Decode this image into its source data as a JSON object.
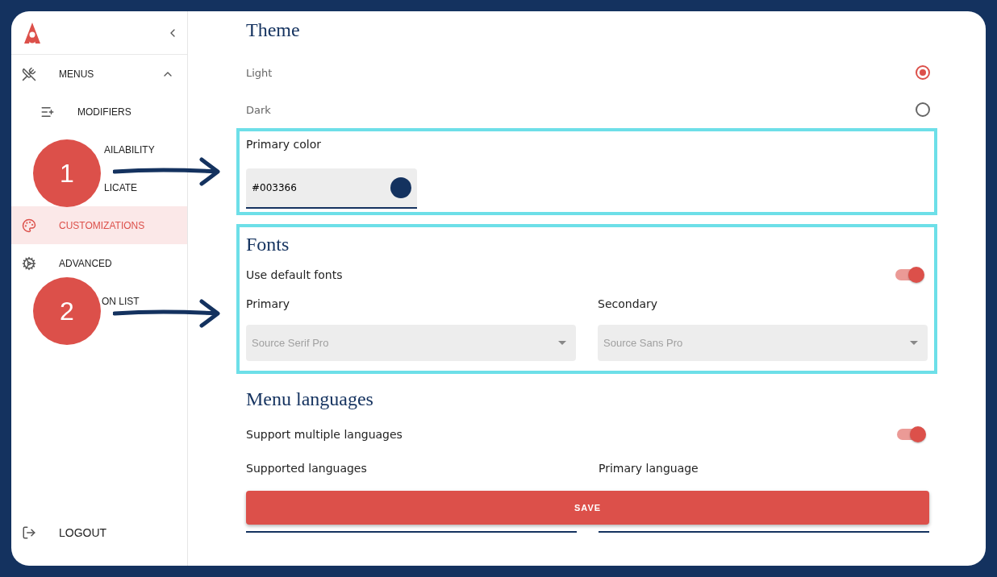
{
  "sidebar": {
    "items": [
      {
        "kind": "group",
        "label": "MENUS",
        "expanded": true,
        "selected": false
      },
      {
        "kind": "sub",
        "label": "MODIFIERS",
        "selected": false
      },
      {
        "kind": "cut-sub",
        "label": "AILABILITY",
        "selected": false
      },
      {
        "kind": "cut-sub",
        "label": "LICATE",
        "selected": false
      },
      {
        "kind": "item",
        "label": "CUSTOMIZATIONS",
        "selected": true
      },
      {
        "kind": "item",
        "label": "ADVANCED",
        "selected": false
      },
      {
        "kind": "cut-item",
        "label": "ON LIST",
        "selected": false
      }
    ],
    "logout": "LOGOUT"
  },
  "theme": {
    "title": "Theme",
    "options": [
      {
        "label": "Light",
        "selected": true
      },
      {
        "label": "Dark",
        "selected": false
      }
    ],
    "primary_color": {
      "label": "Primary color",
      "value": "#003366"
    }
  },
  "fonts": {
    "title": "Fonts",
    "use_default": {
      "label": "Use default fonts",
      "on": true
    },
    "selects": [
      {
        "label": "Primary",
        "placeholder": "Source Serif Pro"
      },
      {
        "label": "Secondary",
        "placeholder": "Source Sans Pro"
      }
    ]
  },
  "languages": {
    "title": "Menu languages",
    "multiple": {
      "label": "Support multiple languages",
      "on": true
    },
    "labels": [
      "Supported languages",
      "Primary language"
    ]
  },
  "save_button": "SAVE",
  "annotations": [
    {
      "label": "1"
    },
    {
      "label": "2"
    }
  ]
}
